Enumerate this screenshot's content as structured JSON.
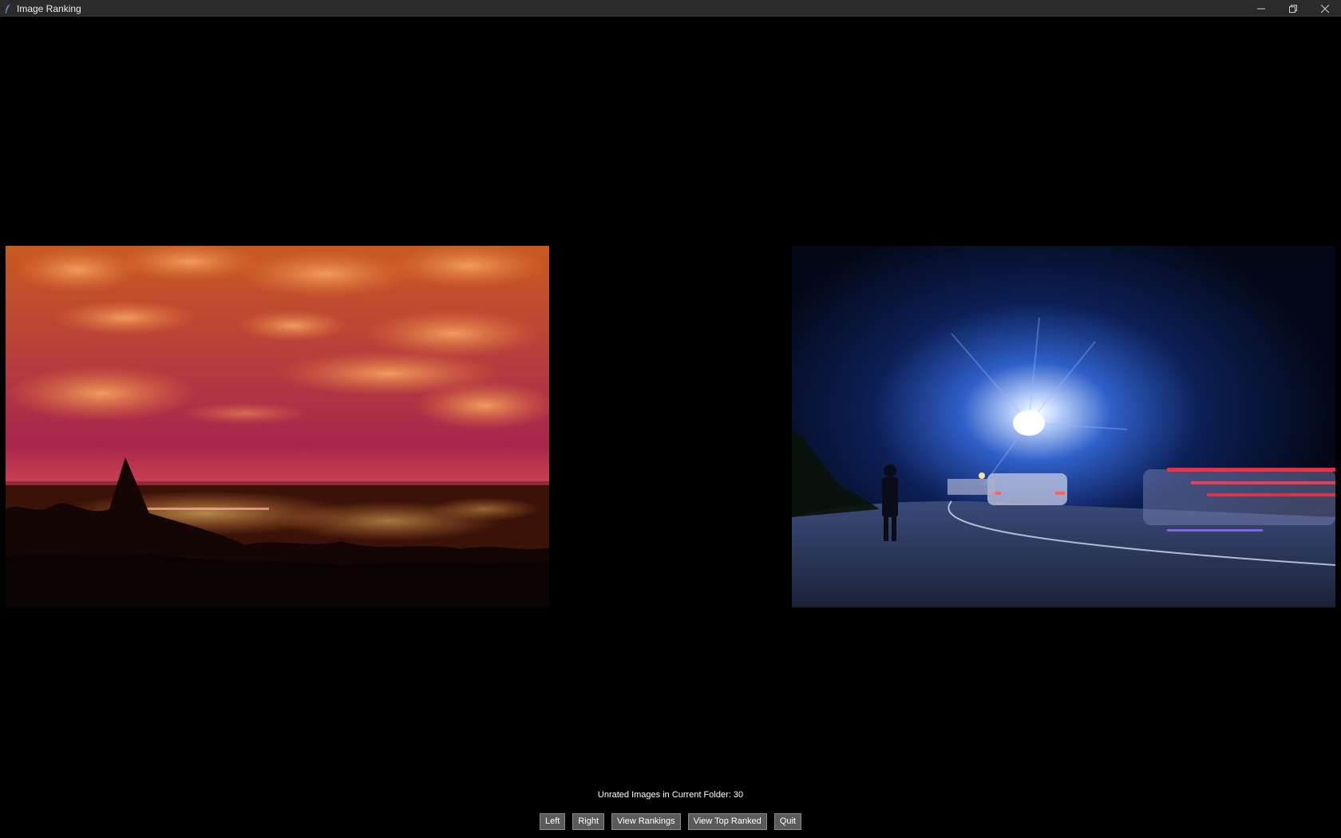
{
  "window": {
    "title": "Image Ranking",
    "icon": "feather-icon",
    "controls": [
      "minimize-icon",
      "restore-icon",
      "close-icon"
    ]
  },
  "images": {
    "left": {
      "icon": "photo-city-night-sunset"
    },
    "right": {
      "icon": "photo-night-road-light-trails"
    }
  },
  "status": {
    "text": "Unrated Images in Current Folder: 30"
  },
  "buttons": {
    "left": "Left",
    "right": "Right",
    "view_rankings": "View Rankings",
    "view_top_ranked": "View Top Ranked",
    "quit": "Quit"
  },
  "colors": {
    "background": "#000000",
    "titlebar": "#2b2b2b",
    "button_bg": "#5a5a5a",
    "button_border": "#8a8a8a"
  }
}
